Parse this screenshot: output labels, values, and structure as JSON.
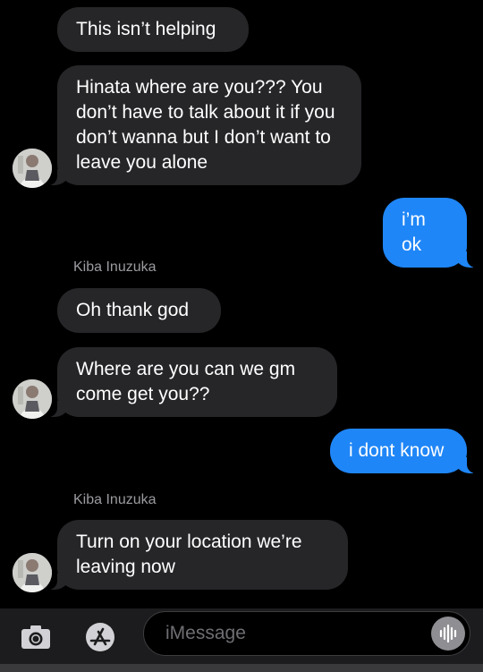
{
  "thread": {
    "messages": [
      {
        "text": "This isn’t helping",
        "direction": "incoming"
      },
      {
        "text": "Hinata where are you??? You don’t have to talk about it if you don’t wanna but I don’t want to leave you alone",
        "direction": "incoming"
      },
      {
        "text": "i’m ok",
        "direction": "outgoing"
      },
      {
        "sender": "Kiba Inuzuka"
      },
      {
        "text": "Oh thank god",
        "direction": "incoming"
      },
      {
        "text": "Where are you can we gm come get you??",
        "direction": "incoming"
      },
      {
        "text": "i dont know",
        "direction": "outgoing"
      },
      {
        "sender": "Kiba Inuzuka"
      },
      {
        "text": "Turn on your location we’re leaving now",
        "direction": "incoming"
      }
    ]
  },
  "compose": {
    "placeholder": "iMessage"
  },
  "icons": {
    "camera": "camera-icon",
    "apps": "app-store-icon",
    "audio": "audio-waveform-icon",
    "avatar": "contact-avatar"
  },
  "colors": {
    "background": "#000000",
    "incoming_bubble": "#262629",
    "outgoing_bubble": "#1f86f7",
    "sender_name": "#9b9ba0",
    "input_bar": "#1c1c1e"
  }
}
